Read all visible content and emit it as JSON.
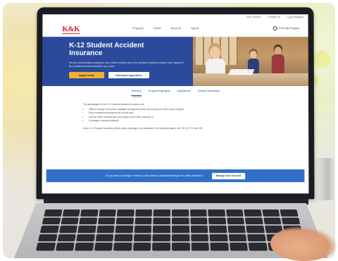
{
  "utility_links": [
    "K&K Careers",
    "Contact Us",
    "Log In/Register"
  ],
  "logo_text": "K&K",
  "nav_items": [
    "Programs",
    "Claims",
    "About Us",
    "Agents"
  ],
  "find_button": "Find My Program",
  "hero": {
    "title_line1": "K-12 Student Accident",
    "title_line2": "Insurance",
    "description": "Are you worried about paying for your child's medical care if an accident requiring medical care happens? Buy student accident insurance you need.",
    "apply_label": "Apply Online",
    "download_label": "Download Application"
  },
  "tabs": [
    "Overview",
    "Program Highlights",
    "Applications",
    "Contact Information"
  ],
  "tab_sub": "Overview",
  "content": {
    "intro": "The advantages of the K-12 student accident insurance are:",
    "bullets": [
      "Offered through the school, available throughout school and during your child's year in grade",
      "Easy enrollment throughout the school year",
      "Choose either medical plan at providers from HMO networks or",
      "Coverage is always available"
    ],
    "note": "Note: K-12 Student Accident policies when coverage is not available in the following states: AK, ND, MT, TX, and RD"
  },
  "banner": {
    "text": "Do you need to manage or renew a policy that you purchased through our online processor?",
    "button": "Manage Your Account"
  },
  "colors": {
    "brand_red": "#d41f2a",
    "hero_blue": "#2b4a9b",
    "apply_yellow": "#f3b233",
    "banner_blue": "#2f6fc8"
  }
}
